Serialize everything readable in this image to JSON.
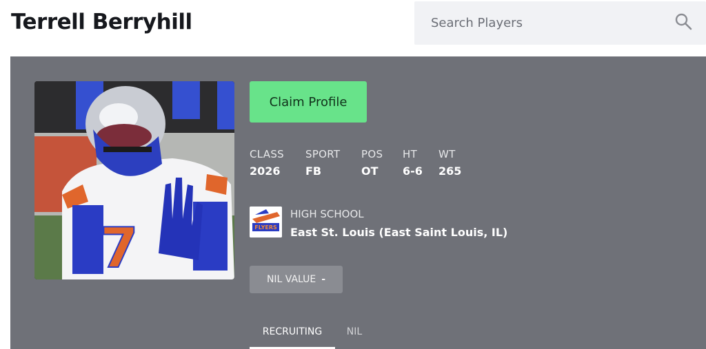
{
  "player": {
    "name": "Terrell Berryhill"
  },
  "search": {
    "placeholder": "Search Players"
  },
  "actions": {
    "claim_label": "Claim Profile"
  },
  "stats": [
    {
      "label": "CLASS",
      "value": "2026"
    },
    {
      "label": "SPORT",
      "value": "FB"
    },
    {
      "label": "POS",
      "value": "OT"
    },
    {
      "label": "HT",
      "value": "6-6"
    },
    {
      "label": "WT",
      "value": "265"
    }
  ],
  "school": {
    "label": "HIGH SCHOOL",
    "name": "East St. Louis (East Saint Louis, IL)",
    "logo_text": "FLYERS"
  },
  "nil": {
    "label": "NIL VALUE",
    "value": "-"
  },
  "tabs": [
    {
      "label": "RECRUITING",
      "active": true
    },
    {
      "label": "NIL",
      "active": false
    }
  ],
  "colors": {
    "panel": "#6f7178",
    "claim_button": "#68e38a",
    "search_bg": "#f1f2f5",
    "jersey_orange": "#e0662c",
    "jersey_blue": "#2a3cc4"
  },
  "icons": {
    "search": "search-icon"
  }
}
